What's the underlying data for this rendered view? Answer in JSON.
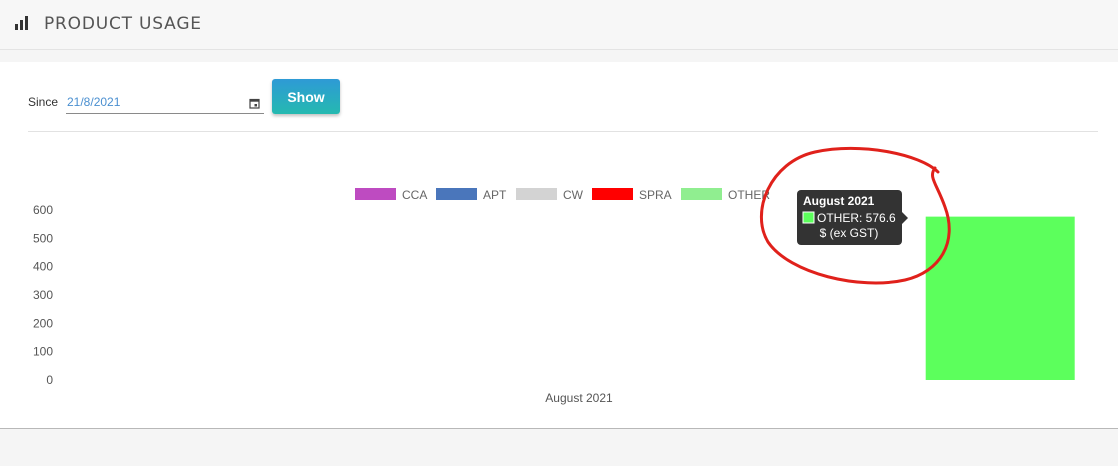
{
  "page": {
    "title": "PRODUCT USAGE"
  },
  "filter": {
    "since_label": "Since",
    "date_value": "21/8/2021",
    "show_label": "Show"
  },
  "chart_data": {
    "type": "bar",
    "categories": [
      "August 2021"
    ],
    "series": [
      {
        "name": "CCA",
        "color": "#be4bc1",
        "values": [
          0
        ]
      },
      {
        "name": "APT",
        "color": "#4a76bb",
        "values": [
          0
        ]
      },
      {
        "name": "CW",
        "color": "#d3d3d3",
        "values": [
          0
        ]
      },
      {
        "name": "SPRA",
        "color": "#ff0000",
        "values": [
          0
        ]
      },
      {
        "name": "OTHER",
        "color": "#90ee90",
        "values": [
          576.6
        ]
      }
    ],
    "bar_color": "#5cff5c",
    "yticks": [
      0,
      100,
      200,
      300,
      400,
      500,
      600
    ],
    "ylim": [
      0,
      600
    ],
    "legend": "top",
    "grid": false,
    "tooltip": {
      "title": "August 2021",
      "line1": "OTHER: 576.6",
      "line2": "$ (ex GST)"
    }
  }
}
